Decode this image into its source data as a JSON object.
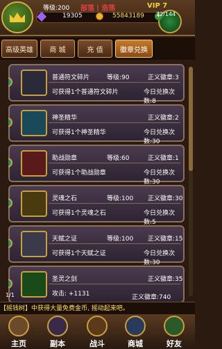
{
  "header": {
    "level": "等级:200",
    "faction": "部落丨浩荡",
    "vip": "VIP 7",
    "gems": "19305",
    "gold": "55843189",
    "energy": "72/144",
    "energy_label": "",
    "energy_fraction": 0.5
  },
  "tabs": [
    "高级英雄",
    "商 城",
    "充 值",
    "徽章兑换"
  ],
  "items": [
    {
      "name": "普通符文碎片",
      "level": "等级:90",
      "cost": "正义徽章:3",
      "desc": "可获得1个普通符文碎片",
      "exchange": "今日兑换次数:8"
    },
    {
      "name": "神圣精华",
      "level": "",
      "cost": "正义徽章:2",
      "desc": "可获得1个神圣精华",
      "exchange": "今日兑换次数:30"
    },
    {
      "name": "助战勋章",
      "level": "等级:60",
      "cost": "正义徽章:1",
      "desc": "可获得1个助战勋章",
      "exchange": "今日兑换次数:30"
    },
    {
      "name": "灵魂之石",
      "level": "等级:100",
      "cost": "正义徽章:30",
      "desc": "可获得1个灵魂之石",
      "exchange": "今日兑换次数:5"
    },
    {
      "name": "天赋之证",
      "level": "等级:100",
      "cost": "正义徽章:15",
      "desc": "可获得1个天赋之证",
      "exchange": "今日兑换次数:30"
    },
    {
      "name": "圣灵之剑",
      "level": "",
      "cost": "正义徽章:35",
      "desc": "攻击: +1131",
      "exchange": ""
    }
  ],
  "footer": {
    "page": "1/1",
    "badges": "正义徽章:740",
    "ticker": "【摇钱树】中获得大量免费金币, 摇动起来吧。"
  },
  "nav": [
    "主页",
    "副本",
    "战斗",
    "商城",
    "好友"
  ]
}
